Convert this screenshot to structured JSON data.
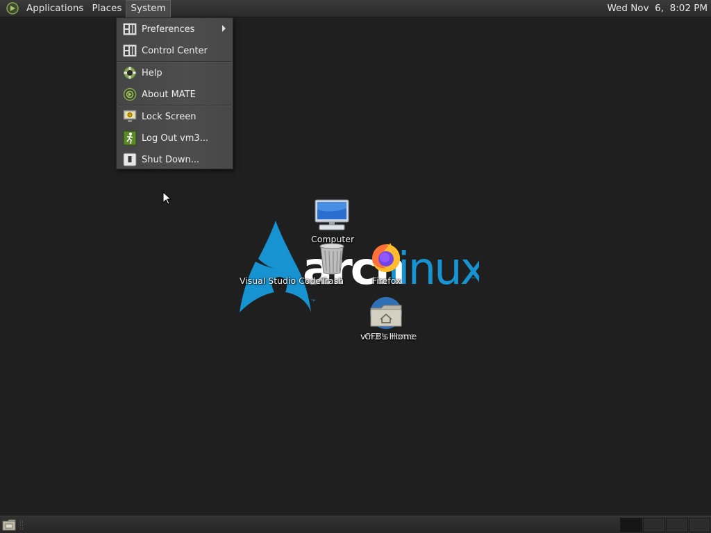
{
  "top_panel": {
    "menus": [
      "Applications",
      "Places",
      "System"
    ],
    "active_menu": "System",
    "clock": "Wed Nov  6,  8:02 PM"
  },
  "system_menu": {
    "items": [
      {
        "label": "Preferences",
        "icon": "preferences-icon",
        "submenu": true
      },
      {
        "label": "Control Center",
        "icon": "control-center-icon"
      },
      {
        "label": "Help",
        "icon": "help-lifebuoy-icon"
      },
      {
        "label": "About MATE",
        "icon": "mate-logo-icon"
      },
      {
        "label": "Lock Screen",
        "icon": "lock-screen-icon"
      },
      {
        "label": "Log Out vm3...",
        "icon": "log-out-icon"
      },
      {
        "label": "Shut Down...",
        "icon": "shut-down-icon"
      }
    ]
  },
  "wallpaper": {
    "logo_text_a": "arch",
    "logo_text_b": "linux",
    "tm": "™"
  },
  "desktop_icons": [
    {
      "label": "Computer",
      "icon": "computer-icon"
    },
    {
      "label": "Trash",
      "icon": "trash-icon"
    },
    {
      "label": "Visual Studio Code",
      "icon": "vscode-icon"
    },
    {
      "label": "Firefox",
      "icon": "firefox-icon"
    },
    {
      "label": "vm3's Home",
      "icon": "home-folder-icon"
    },
    {
      "label": "CFB's Home",
      "icon": "home-folder-icon"
    }
  ],
  "colors": {
    "arch_blue": "#1793d1",
    "desktop_bg": "#1f1f1f",
    "mate_green": "#87a556"
  }
}
